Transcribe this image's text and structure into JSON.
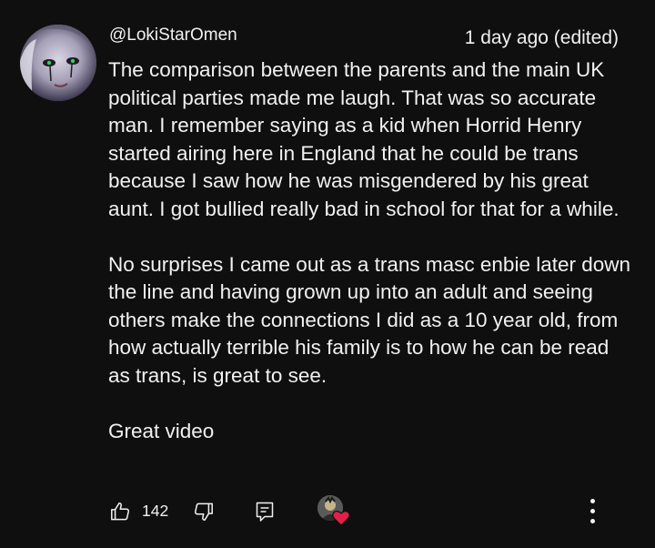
{
  "comment": {
    "author_handle": "@LokiStarOmen",
    "timestamp": "1 day ago (edited)",
    "paragraphs": [
      "The comparison between the parents and the main UK political parties made me laugh. That was so accurate man. I remember saying as a kid when Horrid Henry started airing here in England that he could be trans because I saw how he was misgendered by his great aunt. I got bullied really bad in school for that for a while.",
      "No surprises I came out as a trans masc enbie later down the line and having grown up into an adult and seeing others make the connections I did as a 10 year old, from how actually terrible his family is to how he can be read as trans, is great to see.",
      "Great video"
    ],
    "like_count": "142"
  },
  "icons": {
    "like": "thumbs-up-icon",
    "dislike": "thumbs-down-icon",
    "reply": "reply-icon",
    "creator_heart": "heart-icon",
    "more": "more-vertical-icon"
  },
  "colors": {
    "background": "#0f0f0f",
    "text": "#f1f1f1",
    "heart": "#e0204b"
  }
}
